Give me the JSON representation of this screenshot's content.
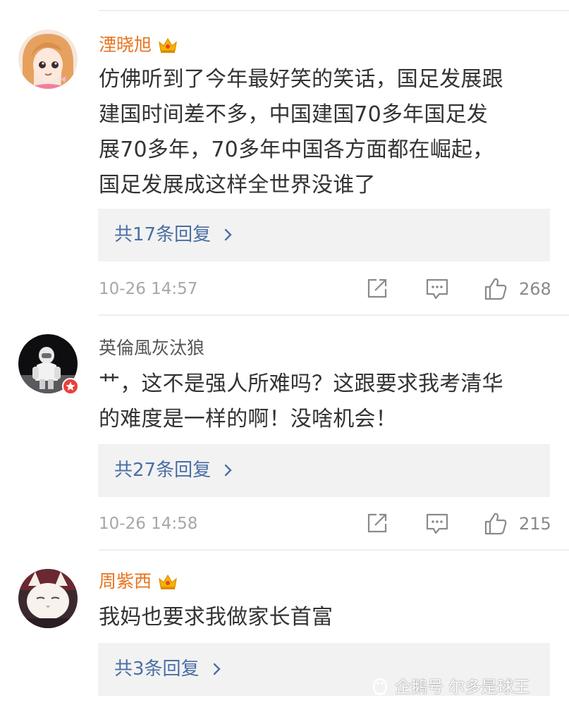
{
  "comments": [
    {
      "username": "湮晓旭",
      "vip": true,
      "name_color": "#e8741f",
      "text": "仿佛听到了今年最好笑的笑话，国足发展跟\n建国时间差不多，中国建国70多年国足发\n展70多年，70多年中国各方面都在崛起，\n国足发展成这样全世界没谁了",
      "replies_label": "共17条回复",
      "date": "10-26 14:57",
      "likes": "268"
    },
    {
      "username": "英倫風灰汰狼",
      "vip": false,
      "name_color": "#555555",
      "text": "艹，这不是强人所难吗？这跟要求我考清华\n的难度是一样的啊！没啥机会！",
      "replies_label": "共27条回复",
      "date": "10-26 14:58",
      "likes": "215"
    },
    {
      "username": "周紫西",
      "vip": true,
      "name_color": "#e8741f",
      "text": "我妈也要求我做家长首富",
      "replies_label": "共3条回复"
    }
  ],
  "icons": {
    "reply_chevron": "chevron-right-icon",
    "share": "share-icon",
    "comment": "comment-icon",
    "like": "thumbs-up-icon",
    "vip": "crown-icon"
  },
  "watermark": {
    "text": "企鹅号 尔多是球王"
  },
  "colors": {
    "link": "#4a6fa5",
    "vip_name": "#e8741f",
    "meta": "#a7a7a7",
    "reply_bg": "#f2f2f2"
  }
}
